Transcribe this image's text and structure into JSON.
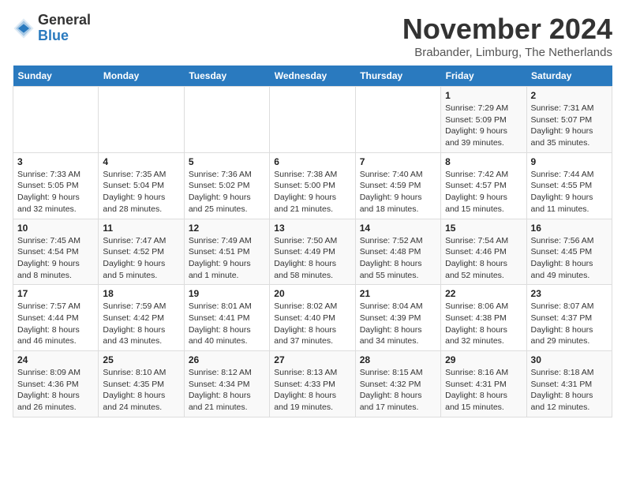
{
  "logo": {
    "general": "General",
    "blue": "Blue"
  },
  "title": "November 2024",
  "subtitle": "Brabander, Limburg, The Netherlands",
  "days_header": [
    "Sunday",
    "Monday",
    "Tuesday",
    "Wednesday",
    "Thursday",
    "Friday",
    "Saturday"
  ],
  "weeks": [
    [
      {
        "day": "",
        "info": ""
      },
      {
        "day": "",
        "info": ""
      },
      {
        "day": "",
        "info": ""
      },
      {
        "day": "",
        "info": ""
      },
      {
        "day": "",
        "info": ""
      },
      {
        "day": "1",
        "info": "Sunrise: 7:29 AM\nSunset: 5:09 PM\nDaylight: 9 hours and 39 minutes."
      },
      {
        "day": "2",
        "info": "Sunrise: 7:31 AM\nSunset: 5:07 PM\nDaylight: 9 hours and 35 minutes."
      }
    ],
    [
      {
        "day": "3",
        "info": "Sunrise: 7:33 AM\nSunset: 5:05 PM\nDaylight: 9 hours and 32 minutes."
      },
      {
        "day": "4",
        "info": "Sunrise: 7:35 AM\nSunset: 5:04 PM\nDaylight: 9 hours and 28 minutes."
      },
      {
        "day": "5",
        "info": "Sunrise: 7:36 AM\nSunset: 5:02 PM\nDaylight: 9 hours and 25 minutes."
      },
      {
        "day": "6",
        "info": "Sunrise: 7:38 AM\nSunset: 5:00 PM\nDaylight: 9 hours and 21 minutes."
      },
      {
        "day": "7",
        "info": "Sunrise: 7:40 AM\nSunset: 4:59 PM\nDaylight: 9 hours and 18 minutes."
      },
      {
        "day": "8",
        "info": "Sunrise: 7:42 AM\nSunset: 4:57 PM\nDaylight: 9 hours and 15 minutes."
      },
      {
        "day": "9",
        "info": "Sunrise: 7:44 AM\nSunset: 4:55 PM\nDaylight: 9 hours and 11 minutes."
      }
    ],
    [
      {
        "day": "10",
        "info": "Sunrise: 7:45 AM\nSunset: 4:54 PM\nDaylight: 9 hours and 8 minutes."
      },
      {
        "day": "11",
        "info": "Sunrise: 7:47 AM\nSunset: 4:52 PM\nDaylight: 9 hours and 5 minutes."
      },
      {
        "day": "12",
        "info": "Sunrise: 7:49 AM\nSunset: 4:51 PM\nDaylight: 9 hours and 1 minute."
      },
      {
        "day": "13",
        "info": "Sunrise: 7:50 AM\nSunset: 4:49 PM\nDaylight: 8 hours and 58 minutes."
      },
      {
        "day": "14",
        "info": "Sunrise: 7:52 AM\nSunset: 4:48 PM\nDaylight: 8 hours and 55 minutes."
      },
      {
        "day": "15",
        "info": "Sunrise: 7:54 AM\nSunset: 4:46 PM\nDaylight: 8 hours and 52 minutes."
      },
      {
        "day": "16",
        "info": "Sunrise: 7:56 AM\nSunset: 4:45 PM\nDaylight: 8 hours and 49 minutes."
      }
    ],
    [
      {
        "day": "17",
        "info": "Sunrise: 7:57 AM\nSunset: 4:44 PM\nDaylight: 8 hours and 46 minutes."
      },
      {
        "day": "18",
        "info": "Sunrise: 7:59 AM\nSunset: 4:42 PM\nDaylight: 8 hours and 43 minutes."
      },
      {
        "day": "19",
        "info": "Sunrise: 8:01 AM\nSunset: 4:41 PM\nDaylight: 8 hours and 40 minutes."
      },
      {
        "day": "20",
        "info": "Sunrise: 8:02 AM\nSunset: 4:40 PM\nDaylight: 8 hours and 37 minutes."
      },
      {
        "day": "21",
        "info": "Sunrise: 8:04 AM\nSunset: 4:39 PM\nDaylight: 8 hours and 34 minutes."
      },
      {
        "day": "22",
        "info": "Sunrise: 8:06 AM\nSunset: 4:38 PM\nDaylight: 8 hours and 32 minutes."
      },
      {
        "day": "23",
        "info": "Sunrise: 8:07 AM\nSunset: 4:37 PM\nDaylight: 8 hours and 29 minutes."
      }
    ],
    [
      {
        "day": "24",
        "info": "Sunrise: 8:09 AM\nSunset: 4:36 PM\nDaylight: 8 hours and 26 minutes."
      },
      {
        "day": "25",
        "info": "Sunrise: 8:10 AM\nSunset: 4:35 PM\nDaylight: 8 hours and 24 minutes."
      },
      {
        "day": "26",
        "info": "Sunrise: 8:12 AM\nSunset: 4:34 PM\nDaylight: 8 hours and 21 minutes."
      },
      {
        "day": "27",
        "info": "Sunrise: 8:13 AM\nSunset: 4:33 PM\nDaylight: 8 hours and 19 minutes."
      },
      {
        "day": "28",
        "info": "Sunrise: 8:15 AM\nSunset: 4:32 PM\nDaylight: 8 hours and 17 minutes."
      },
      {
        "day": "29",
        "info": "Sunrise: 8:16 AM\nSunset: 4:31 PM\nDaylight: 8 hours and 15 minutes."
      },
      {
        "day": "30",
        "info": "Sunrise: 8:18 AM\nSunset: 4:31 PM\nDaylight: 8 hours and 12 minutes."
      }
    ]
  ]
}
